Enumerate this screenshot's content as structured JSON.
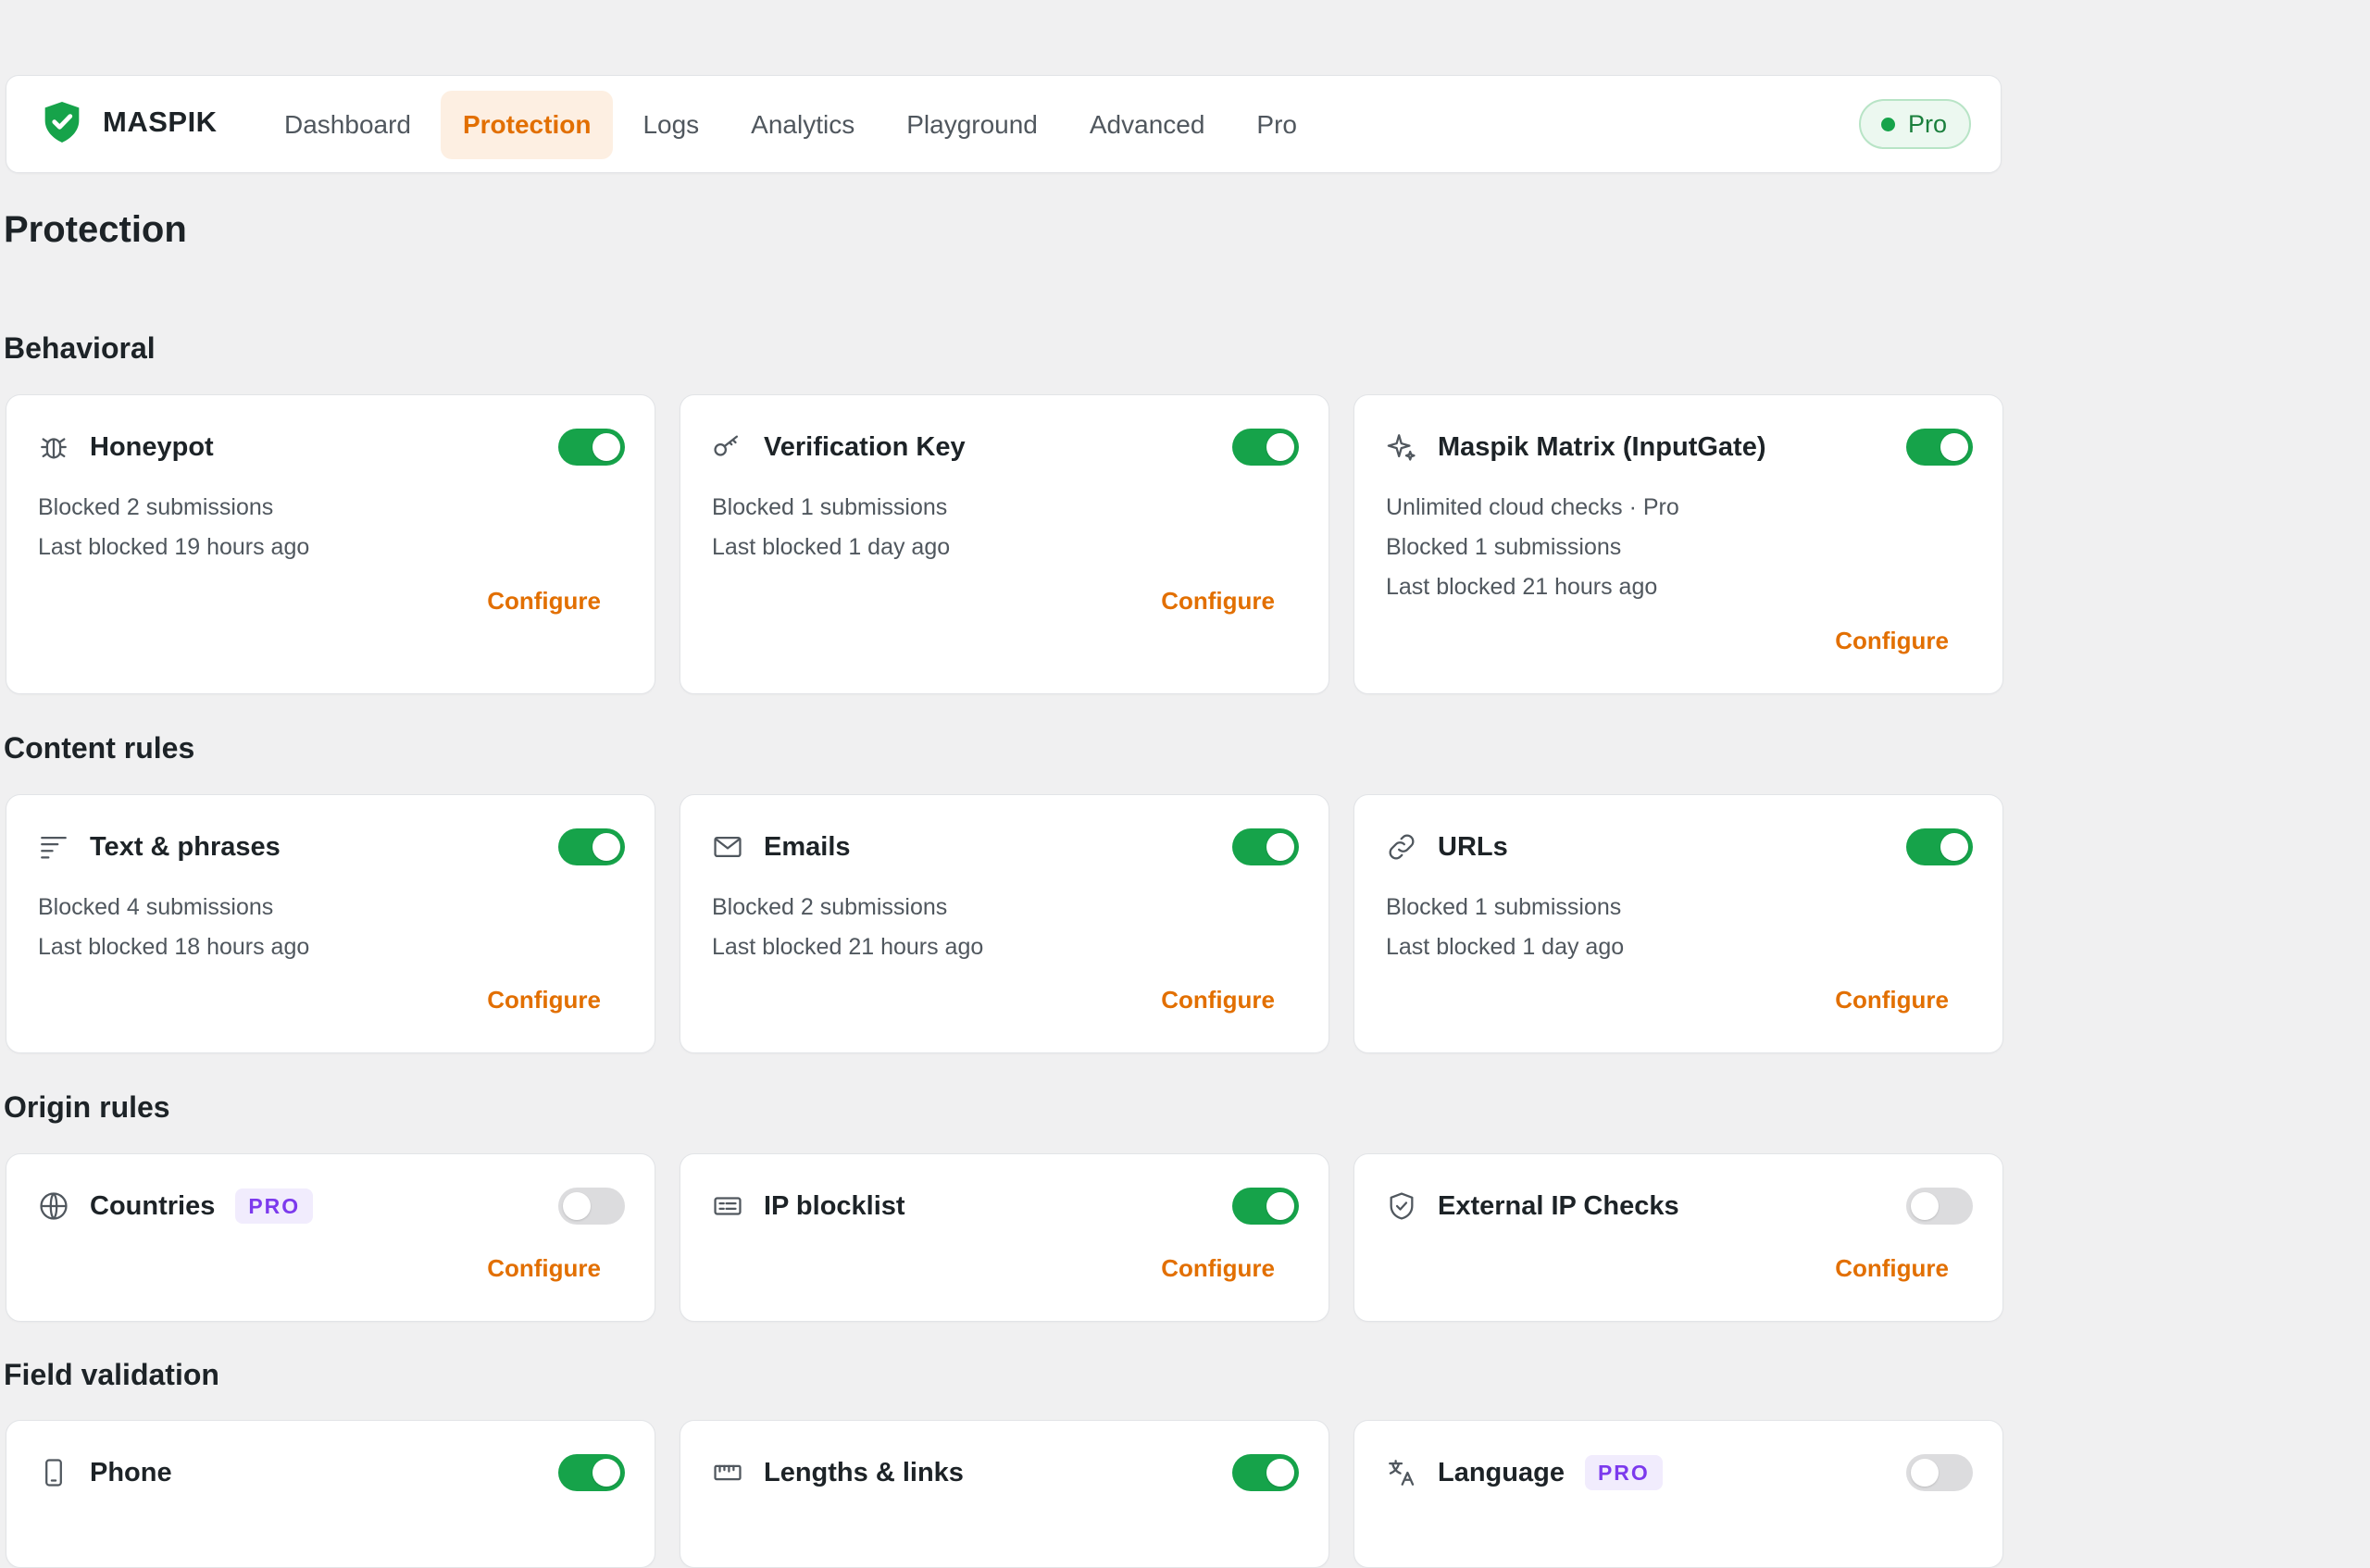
{
  "brand": {
    "name": "MASPIK",
    "accent": "#16a34a"
  },
  "nav": {
    "items": [
      "Dashboard",
      "Protection",
      "Logs",
      "Analytics",
      "Playground",
      "Advanced",
      "Pro"
    ],
    "active": "Protection"
  },
  "plan_badge": "Pro",
  "page_title": "Protection",
  "configure_label": "Configure",
  "sections": [
    {
      "title": "Behavioral",
      "cards": [
        {
          "title": "Honeypot",
          "icon": "bug-icon",
          "enabled": true,
          "pro": false,
          "lines": [
            "Blocked 2 submissions",
            "Last blocked 19 hours ago"
          ]
        },
        {
          "title": "Verification Key",
          "icon": "key-icon",
          "enabled": true,
          "pro": false,
          "lines": [
            "Blocked 1 submissions",
            "Last blocked 1 day ago"
          ]
        },
        {
          "title": "Maspik Matrix (InputGate)",
          "icon": "sparkle-icon",
          "enabled": true,
          "pro": false,
          "lines": [
            "Unlimited cloud checks · Pro",
            "Blocked 1 submissions",
            "Last blocked 21 hours ago"
          ]
        }
      ]
    },
    {
      "title": "Content rules",
      "cards": [
        {
          "title": "Text & phrases",
          "icon": "text-lines-icon",
          "enabled": true,
          "pro": false,
          "lines": [
            "Blocked 4 submissions",
            "Last blocked 18 hours ago"
          ]
        },
        {
          "title": "Emails",
          "icon": "envelope-icon",
          "enabled": true,
          "pro": false,
          "lines": [
            "Blocked 2 submissions",
            "Last blocked 21 hours ago"
          ]
        },
        {
          "title": "URLs",
          "icon": "link-icon",
          "enabled": true,
          "pro": false,
          "lines": [
            "Blocked 1 submissions",
            "Last blocked 1 day ago"
          ]
        }
      ]
    },
    {
      "title": "Origin rules",
      "cards": [
        {
          "title": "Countries",
          "icon": "globe-icon",
          "enabled": false,
          "pro": true,
          "pro_label": "PRO",
          "lines": []
        },
        {
          "title": "IP blocklist",
          "icon": "ip-list-icon",
          "enabled": true,
          "pro": false,
          "lines": []
        },
        {
          "title": "External IP Checks",
          "icon": "shield-check-icon",
          "enabled": false,
          "pro": false,
          "lines": []
        }
      ]
    },
    {
      "title": "Field validation",
      "cards": [
        {
          "title": "Phone",
          "icon": "phone-icon",
          "enabled": true,
          "pro": false,
          "lines": []
        },
        {
          "title": "Lengths & links",
          "icon": "ruler-icon",
          "enabled": true,
          "pro": false,
          "lines": []
        },
        {
          "title": "Language",
          "icon": "translate-icon",
          "enabled": false,
          "pro": true,
          "pro_label": "PRO",
          "lines": []
        }
      ]
    }
  ]
}
